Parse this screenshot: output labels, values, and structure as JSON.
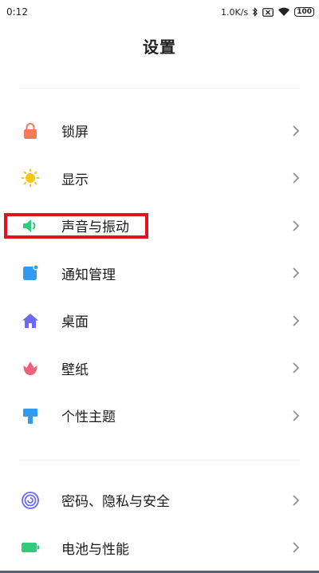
{
  "status_bar": {
    "time": "0:12",
    "network_speed": "1.0K/s",
    "battery_level": "100",
    "icons": [
      "bluetooth-icon",
      "sim-disabled-icon",
      "wifi-icon",
      "battery-icon"
    ]
  },
  "header": {
    "title": "设置"
  },
  "colors": {
    "lock": "#f47a5c",
    "display": "#f5c518",
    "sound": "#2fcc7a",
    "notification": "#2f9bf2",
    "desktop": "#6b6af0",
    "wallpaper": "#f0607a",
    "theme": "#2f9bf2",
    "privacy": "#6b6af0",
    "battery": "#2fcc7a",
    "highlight": "#e4131b"
  },
  "settings": {
    "items": [
      {
        "label": "锁屏",
        "icon": "lock-icon"
      },
      {
        "label": "显示",
        "icon": "sun-icon"
      },
      {
        "label": "声音与振动",
        "icon": "speaker-icon"
      },
      {
        "label": "通知管理",
        "icon": "notification-icon"
      },
      {
        "label": "桌面",
        "icon": "home-icon"
      },
      {
        "label": "壁纸",
        "icon": "tulip-icon"
      },
      {
        "label": "个性主题",
        "icon": "paintbrush-icon"
      }
    ],
    "items2": [
      {
        "label": "密码、隐私与安全",
        "icon": "fingerprint-icon"
      },
      {
        "label": "电池与性能",
        "icon": "battery-performance-icon"
      }
    ]
  }
}
